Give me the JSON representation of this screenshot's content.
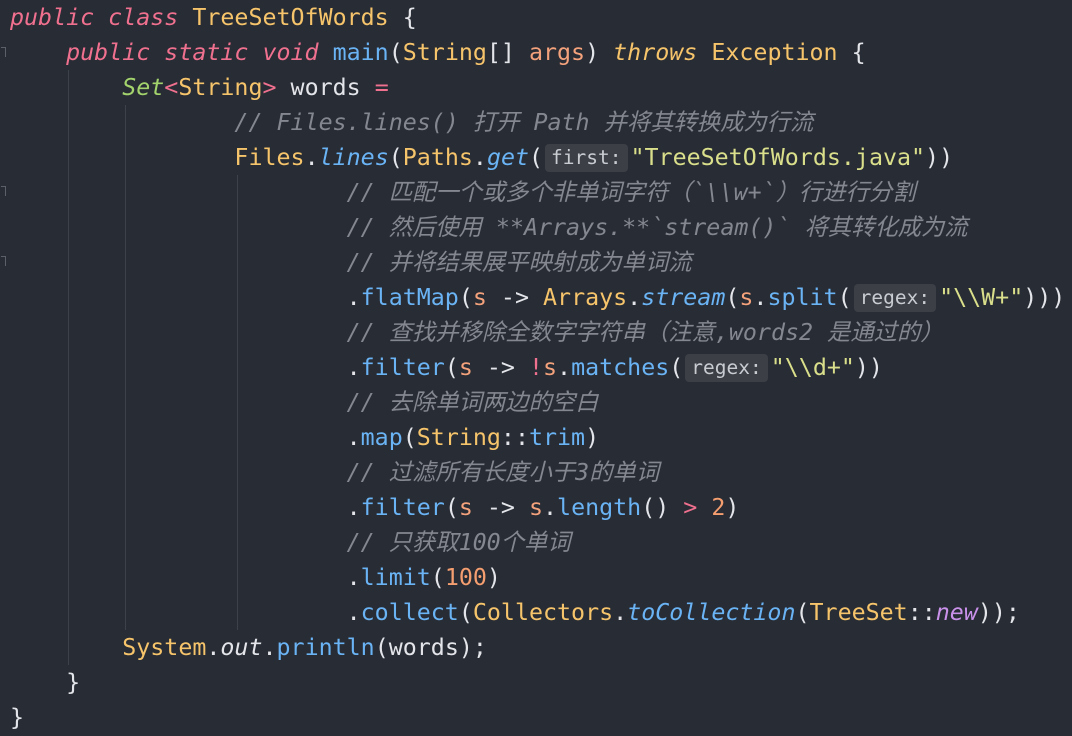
{
  "theme": {
    "background": "#282c34",
    "foreground": "#e3e5ea",
    "indent_guide": "#3d414a",
    "hint_background": "#3c3f46",
    "hint_foreground": "#c9ccd1",
    "fold_marker": "#5c6068"
  },
  "editor": {
    "lines": [
      [
        {
          "t": "public class ",
          "fg": "#f0708f",
          "it": true
        },
        {
          "t": "TreeSetOfWords",
          "fg": "#f6c46b"
        },
        {
          "t": " {"
        }
      ],
      [
        {
          "t": "    "
        },
        {
          "t": "public static void ",
          "fg": "#f0708f",
          "it": true
        },
        {
          "t": "main",
          "fg": "#6ab3f4"
        },
        {
          "t": "("
        },
        {
          "t": "String",
          "fg": "#f6c46b"
        },
        {
          "t": "[] "
        },
        {
          "t": "args",
          "fg": "#f3a27c"
        },
        {
          "t": ") "
        },
        {
          "t": "throws",
          "fg": "#f6c46b",
          "it": true
        },
        {
          "t": " "
        },
        {
          "t": "Exception",
          "fg": "#f6c46b"
        },
        {
          "t": " {"
        }
      ],
      [
        {
          "t": "        "
        },
        {
          "t": "Set",
          "fg": "#a3d36c",
          "it": true
        },
        {
          "t": "<",
          "fg": "#f0708f"
        },
        {
          "t": "String",
          "fg": "#f6c46b"
        },
        {
          "t": ">",
          "fg": "#f0708f"
        },
        {
          "t": " words "
        },
        {
          "t": "=",
          "fg": "#f0708f"
        }
      ],
      [
        {
          "t": "                // Files.lines() 打开 Path 并将其转换成为行流",
          "fg": "#848790",
          "it": true
        }
      ],
      [
        {
          "t": "                "
        },
        {
          "t": "Files",
          "fg": "#f6c46b"
        },
        {
          "t": "."
        },
        {
          "t": "lines",
          "fg": "#6ab3f4",
          "it": true
        },
        {
          "t": "("
        },
        {
          "t": "Paths",
          "fg": "#f6c46b"
        },
        {
          "t": "."
        },
        {
          "t": "get",
          "fg": "#6ab3f4",
          "it": true
        },
        {
          "t": "("
        },
        {
          "t": "first:",
          "hint": true
        },
        {
          "t": "\"TreeSetOfWords.java\"",
          "fg": "#dadf8b"
        },
        {
          "t": "))"
        }
      ],
      [
        {
          "t": "                        // 匹配一个或多个非单词字符（`\\\\w+`）行进行分割",
          "fg": "#848790",
          "it": true
        }
      ],
      [
        {
          "t": "                        // 然后使用 **Arrays.**`stream()` 将其转化成为流",
          "fg": "#848790",
          "it": true
        }
      ],
      [
        {
          "t": "                        // 并将结果展平映射成为单词流",
          "fg": "#848790",
          "it": true
        }
      ],
      [
        {
          "t": "                        ."
        },
        {
          "t": "flatMap",
          "fg": "#6ab3f4"
        },
        {
          "t": "("
        },
        {
          "t": "s",
          "fg": "#f3a27c"
        },
        {
          "t": " -> "
        },
        {
          "t": "Arrays",
          "fg": "#f6c46b"
        },
        {
          "t": "."
        },
        {
          "t": "stream",
          "fg": "#6ab3f4",
          "it": true
        },
        {
          "t": "("
        },
        {
          "t": "s",
          "fg": "#f3a27c"
        },
        {
          "t": "."
        },
        {
          "t": "split",
          "fg": "#6ab3f4"
        },
        {
          "t": "("
        },
        {
          "t": "regex:",
          "hint": true
        },
        {
          "t": "\"\\\\W+\"",
          "fg": "#dadf8b"
        },
        {
          "t": ")))"
        }
      ],
      [
        {
          "t": "                        // 查找并移除全数字字符串（注意,words2 是通过的）",
          "fg": "#848790",
          "it": true
        }
      ],
      [
        {
          "t": "                        ."
        },
        {
          "t": "filter",
          "fg": "#6ab3f4"
        },
        {
          "t": "("
        },
        {
          "t": "s",
          "fg": "#f3a27c"
        },
        {
          "t": " -> "
        },
        {
          "t": "!",
          "fg": "#f0708f"
        },
        {
          "t": "s",
          "fg": "#f3a27c"
        },
        {
          "t": "."
        },
        {
          "t": "matches",
          "fg": "#6ab3f4"
        },
        {
          "t": "("
        },
        {
          "t": "regex:",
          "hint": true
        },
        {
          "t": "\"\\\\d+\"",
          "fg": "#dadf8b"
        },
        {
          "t": "))"
        }
      ],
      [
        {
          "t": "                        // 去除单词两边的空白",
          "fg": "#848790",
          "it": true
        }
      ],
      [
        {
          "t": "                        ."
        },
        {
          "t": "map",
          "fg": "#6ab3f4"
        },
        {
          "t": "("
        },
        {
          "t": "String",
          "fg": "#f6c46b"
        },
        {
          "t": "::"
        },
        {
          "t": "trim",
          "fg": "#6ab3f4"
        },
        {
          "t": ")"
        }
      ],
      [
        {
          "t": "                        // 过滤所有长度小于3的单词",
          "fg": "#848790",
          "it": true
        }
      ],
      [
        {
          "t": "                        ."
        },
        {
          "t": "filter",
          "fg": "#6ab3f4"
        },
        {
          "t": "("
        },
        {
          "t": "s",
          "fg": "#f3a27c"
        },
        {
          "t": " -> "
        },
        {
          "t": "s",
          "fg": "#f3a27c"
        },
        {
          "t": "."
        },
        {
          "t": "length",
          "fg": "#6ab3f4"
        },
        {
          "t": "() "
        },
        {
          "t": ">",
          "fg": "#f0708f"
        },
        {
          "t": " "
        },
        {
          "t": "2",
          "fg": "#f59e70"
        },
        {
          "t": ")"
        }
      ],
      [
        {
          "t": "                        // 只获取100个单词",
          "fg": "#848790",
          "it": true
        }
      ],
      [
        {
          "t": "                        ."
        },
        {
          "t": "limit",
          "fg": "#6ab3f4"
        },
        {
          "t": "("
        },
        {
          "t": "100",
          "fg": "#f59e70"
        },
        {
          "t": ")"
        }
      ],
      [
        {
          "t": "                        ."
        },
        {
          "t": "collect",
          "fg": "#6ab3f4"
        },
        {
          "t": "("
        },
        {
          "t": "Collectors",
          "fg": "#f6c46b"
        },
        {
          "t": "."
        },
        {
          "t": "toCollection",
          "fg": "#6ab3f4",
          "it": true
        },
        {
          "t": "("
        },
        {
          "t": "TreeSet",
          "fg": "#f6c46b"
        },
        {
          "t": "::"
        },
        {
          "t": "new",
          "fg": "#c991ea",
          "it": true
        },
        {
          "t": "));"
        }
      ],
      [
        {
          "t": "        "
        },
        {
          "t": "System",
          "fg": "#f6c46b"
        },
        {
          "t": "."
        },
        {
          "t": "out",
          "it": true
        },
        {
          "t": "."
        },
        {
          "t": "println",
          "fg": "#6ab3f4"
        },
        {
          "t": "("
        },
        {
          "t": "words"
        },
        {
          "t": ");"
        }
      ],
      [
        {
          "t": "    }"
        }
      ],
      [
        {
          "t": "}"
        }
      ]
    ]
  }
}
